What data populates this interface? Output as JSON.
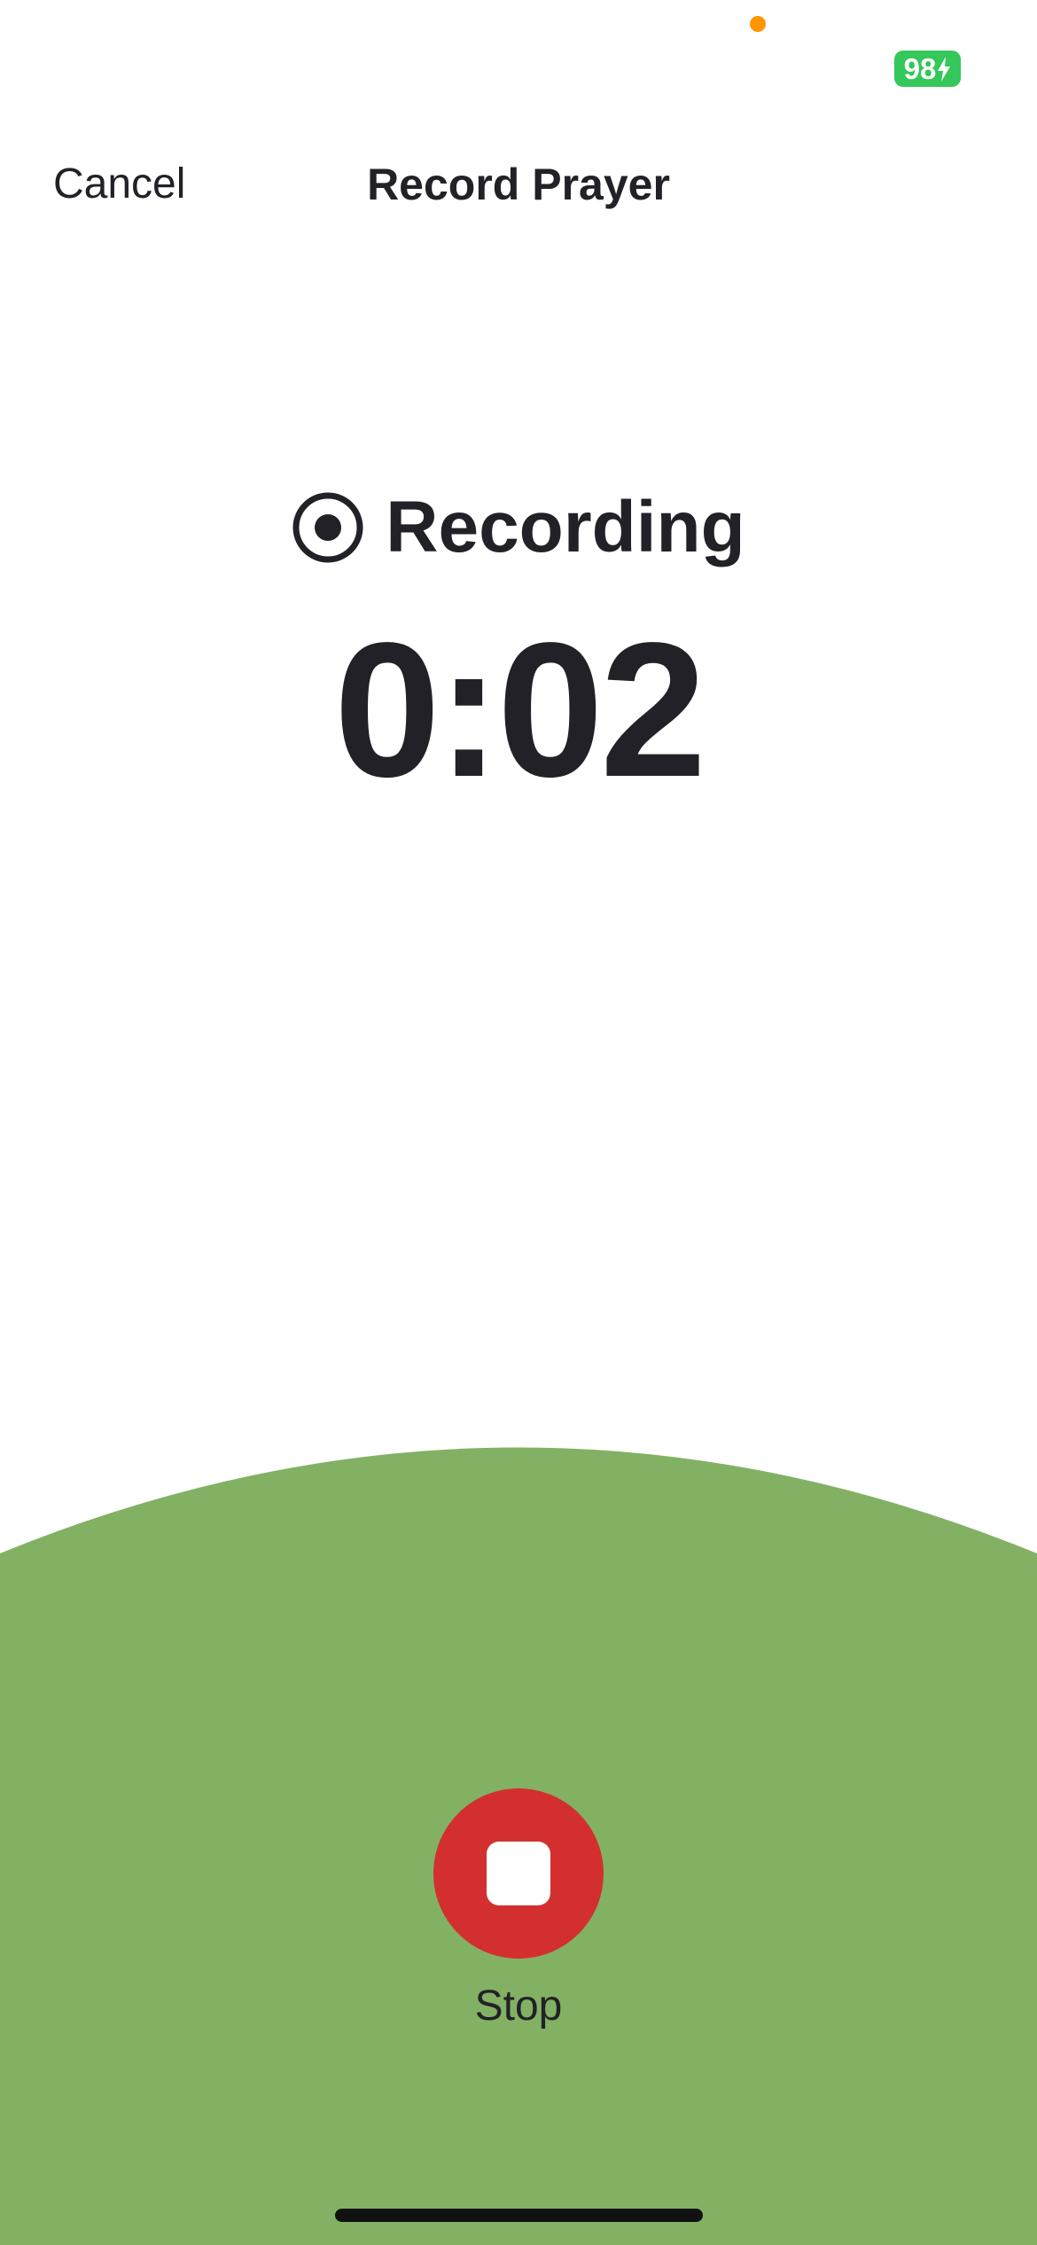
{
  "status_bar": {
    "battery_level": "98",
    "battery_color": "#34C759",
    "privacy_indicator_color": "#FF9500",
    "charging_icon": "bolt-icon"
  },
  "nav": {
    "cancel_label": "Cancel",
    "title": "Record Prayer"
  },
  "recording": {
    "icon": "record-icon",
    "label": "Recording",
    "elapsed": "0:02"
  },
  "controls": {
    "stop_label": "Stop",
    "stop_icon": "stop-icon",
    "stop_color": "#D32F2F"
  },
  "colors": {
    "panel_green": "#82B163",
    "text_dark": "#222128"
  }
}
